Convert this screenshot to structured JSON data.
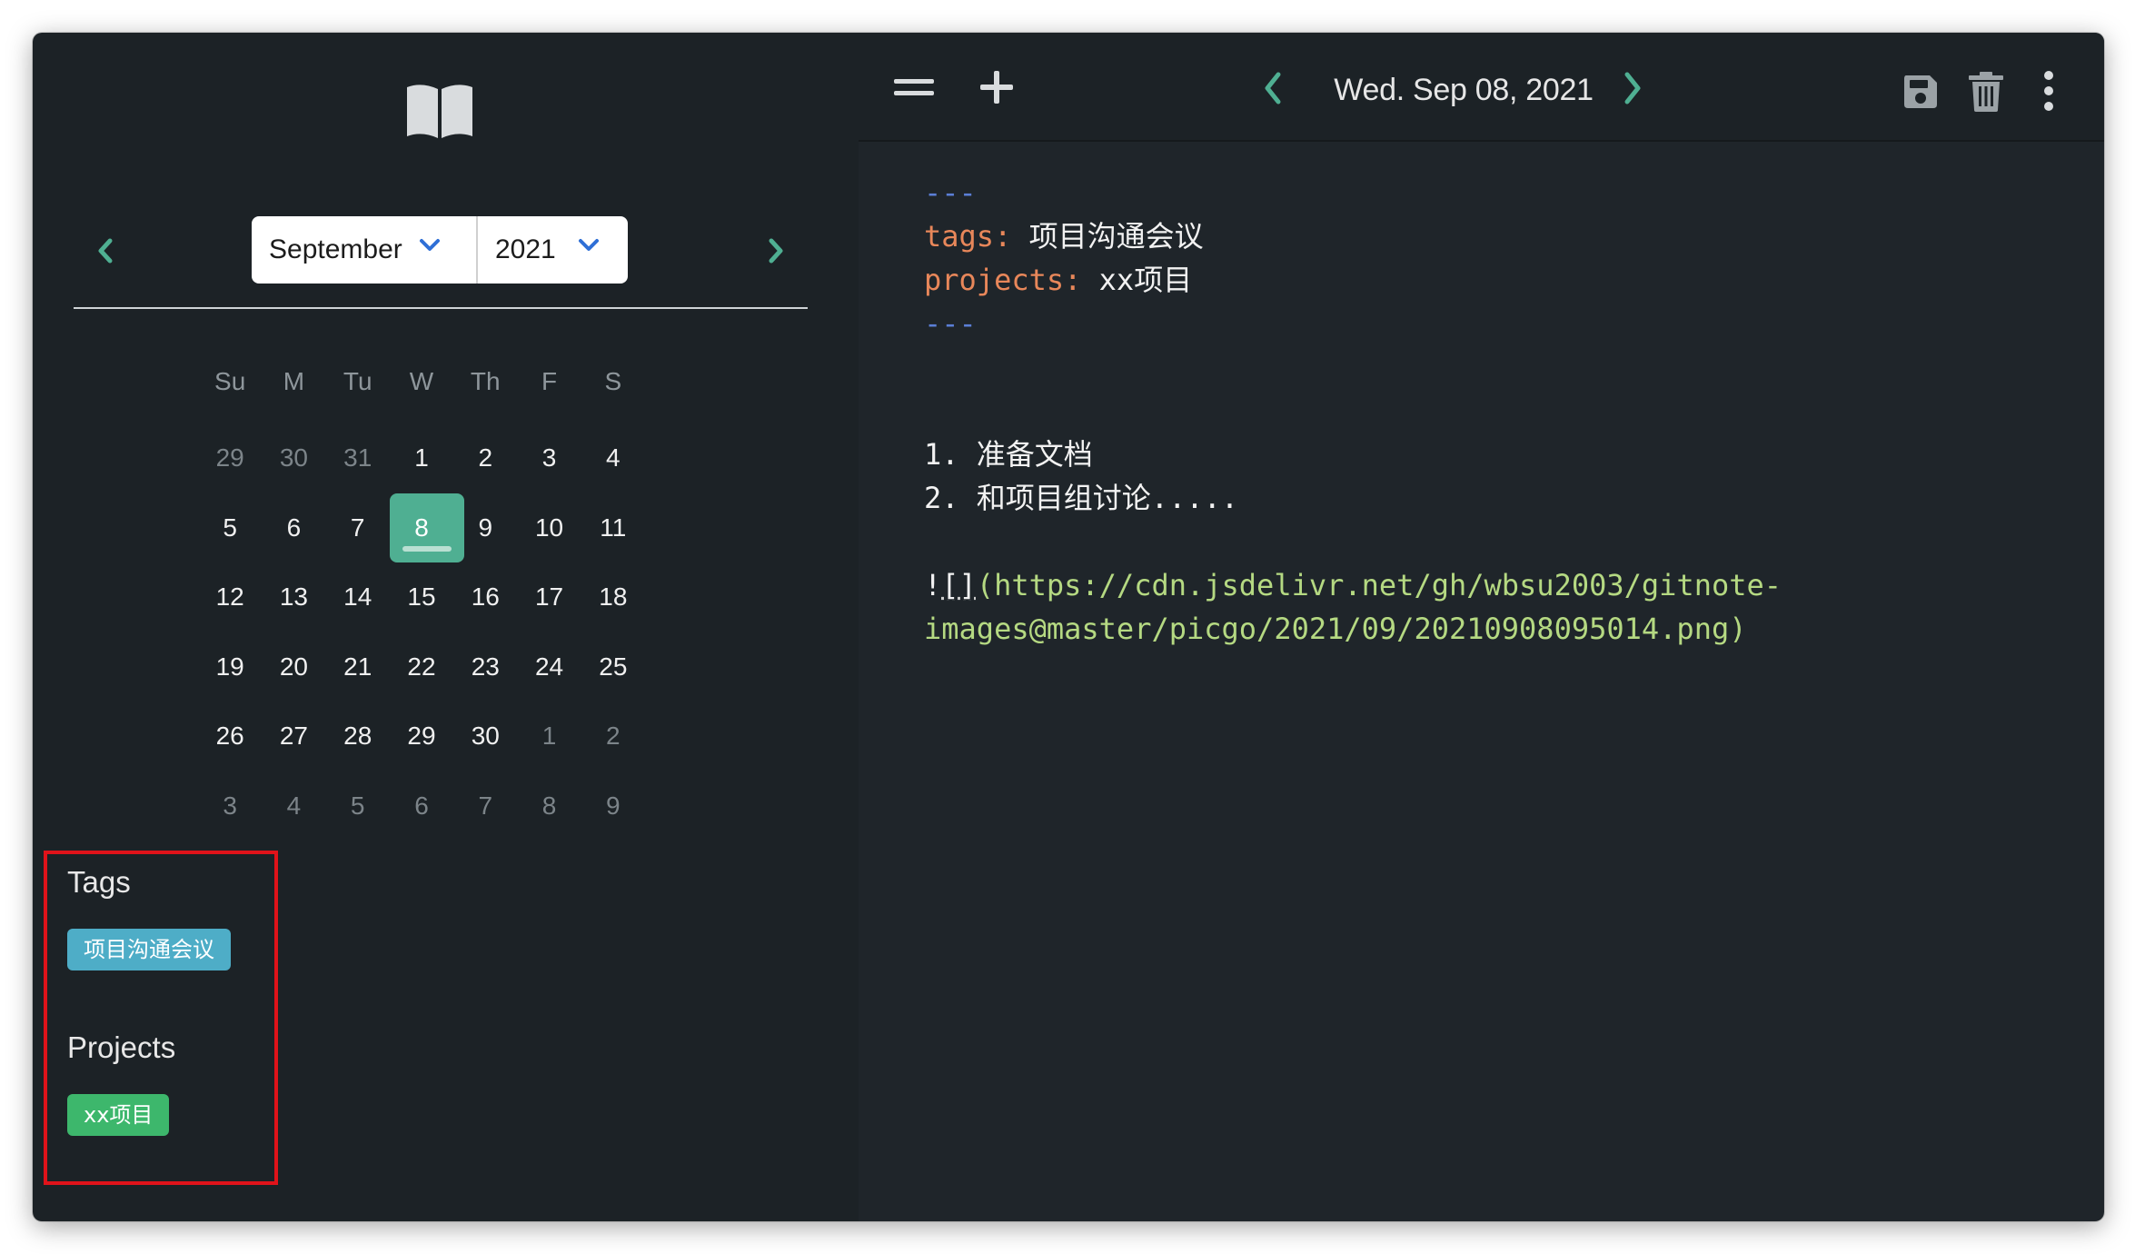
{
  "colors": {
    "sidebar_bg": "#1c2226",
    "main_bg": "#1f252a",
    "accent_teal": "#4faf92",
    "tag_chip": "#4eadc7",
    "project_chip": "#3db76c",
    "highlight_box": "#e0131a",
    "frontmatter_key": "#e8875a",
    "link_url": "#b5d982"
  },
  "sidebar": {
    "logo_icon": "open-book-icon",
    "month_select": "September",
    "year_select": "2021",
    "weekdays": [
      "Su",
      "M",
      "Tu",
      "W",
      "Th",
      "F",
      "S"
    ],
    "weeks": [
      [
        "29",
        "30",
        "31",
        "1",
        "2",
        "3",
        "4"
      ],
      [
        "5",
        "6",
        "7",
        "8",
        "9",
        "10",
        "11"
      ],
      [
        "12",
        "13",
        "14",
        "15",
        "16",
        "17",
        "18"
      ],
      [
        "19",
        "20",
        "21",
        "22",
        "23",
        "24",
        "25"
      ],
      [
        "26",
        "27",
        "28",
        "29",
        "30",
        "1",
        "2"
      ],
      [
        "3",
        "4",
        "5",
        "6",
        "7",
        "8",
        "9"
      ]
    ],
    "selected_day": "8",
    "tags_title": "Tags",
    "tags": [
      "项目沟通会议"
    ],
    "projects_title": "Projects",
    "projects": [
      "xx项目"
    ]
  },
  "toolbar": {
    "menu_icon": "hamburger-icon",
    "add_icon": "plus-icon",
    "prev_icon": "chevron-left-icon",
    "date": "Wed. Sep 08, 2021",
    "next_icon": "chevron-right-icon",
    "save_icon": "save-icon",
    "delete_icon": "trash-icon",
    "more_icon": "more-vertical-icon"
  },
  "editor": {
    "fm_open": "---",
    "tags_key": "tags:",
    "tags_value": " 项目沟通会议",
    "projects_key": "projects:",
    "projects_value": " xx项目",
    "fm_close": "---",
    "list_1": "1. 准备文档",
    "list_2": "2. 和项目组讨论.....",
    "image_prefix": "!",
    "image_brackets": "[]",
    "image_url_line1": "(https://cdn.jsdelivr.net/gh/wbsu2003/gitnote-",
    "image_url_line2": "images@master/picgo/2021/09/20210908095014.png)"
  }
}
